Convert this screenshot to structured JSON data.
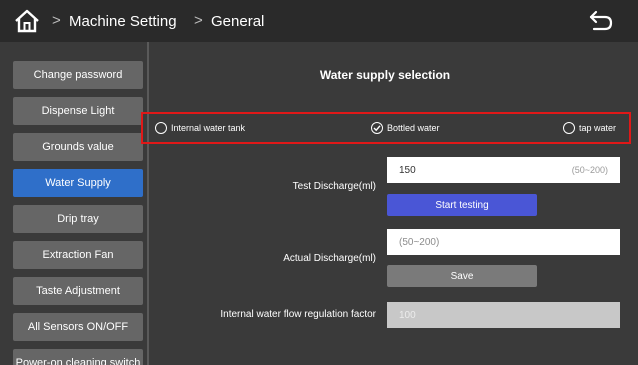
{
  "header": {
    "breadcrumb": [
      "Machine Setting",
      "General"
    ],
    "home_icon": "home-icon",
    "back_icon": "back-arrow-icon"
  },
  "sidebar": {
    "items": [
      {
        "label": "Change password",
        "active": false
      },
      {
        "label": "Dispense Light",
        "active": false
      },
      {
        "label": "Grounds value",
        "active": false
      },
      {
        "label": "Water Supply",
        "active": true
      },
      {
        "label": "Drip tray",
        "active": false
      },
      {
        "label": "Extraction Fan",
        "active": false
      },
      {
        "label": "Taste Adjustment",
        "active": false
      },
      {
        "label": "All Sensors ON/OFF",
        "active": false
      },
      {
        "label": "Power-on cleaning switch",
        "active": false
      }
    ]
  },
  "main": {
    "title": "Water supply selection",
    "options": [
      {
        "label": "Internal water tank",
        "selected": false
      },
      {
        "label": "Bottled water",
        "selected": true
      },
      {
        "label": "tap water",
        "selected": false
      }
    ],
    "test_discharge": {
      "label": "Test Discharge(ml)",
      "value": "150",
      "range_hint": "(50~200)",
      "button": "Start testing"
    },
    "actual_discharge": {
      "label": "Actual Discharge(ml)",
      "placeholder": "(50~200)",
      "button": "Save"
    },
    "flow_factor": {
      "label": "Internal water flow regulation factor",
      "value": "100"
    }
  },
  "colors": {
    "accent_active": "#2f6fc9",
    "button_primary": "#4a56d6",
    "highlight_border": "#e01818"
  }
}
